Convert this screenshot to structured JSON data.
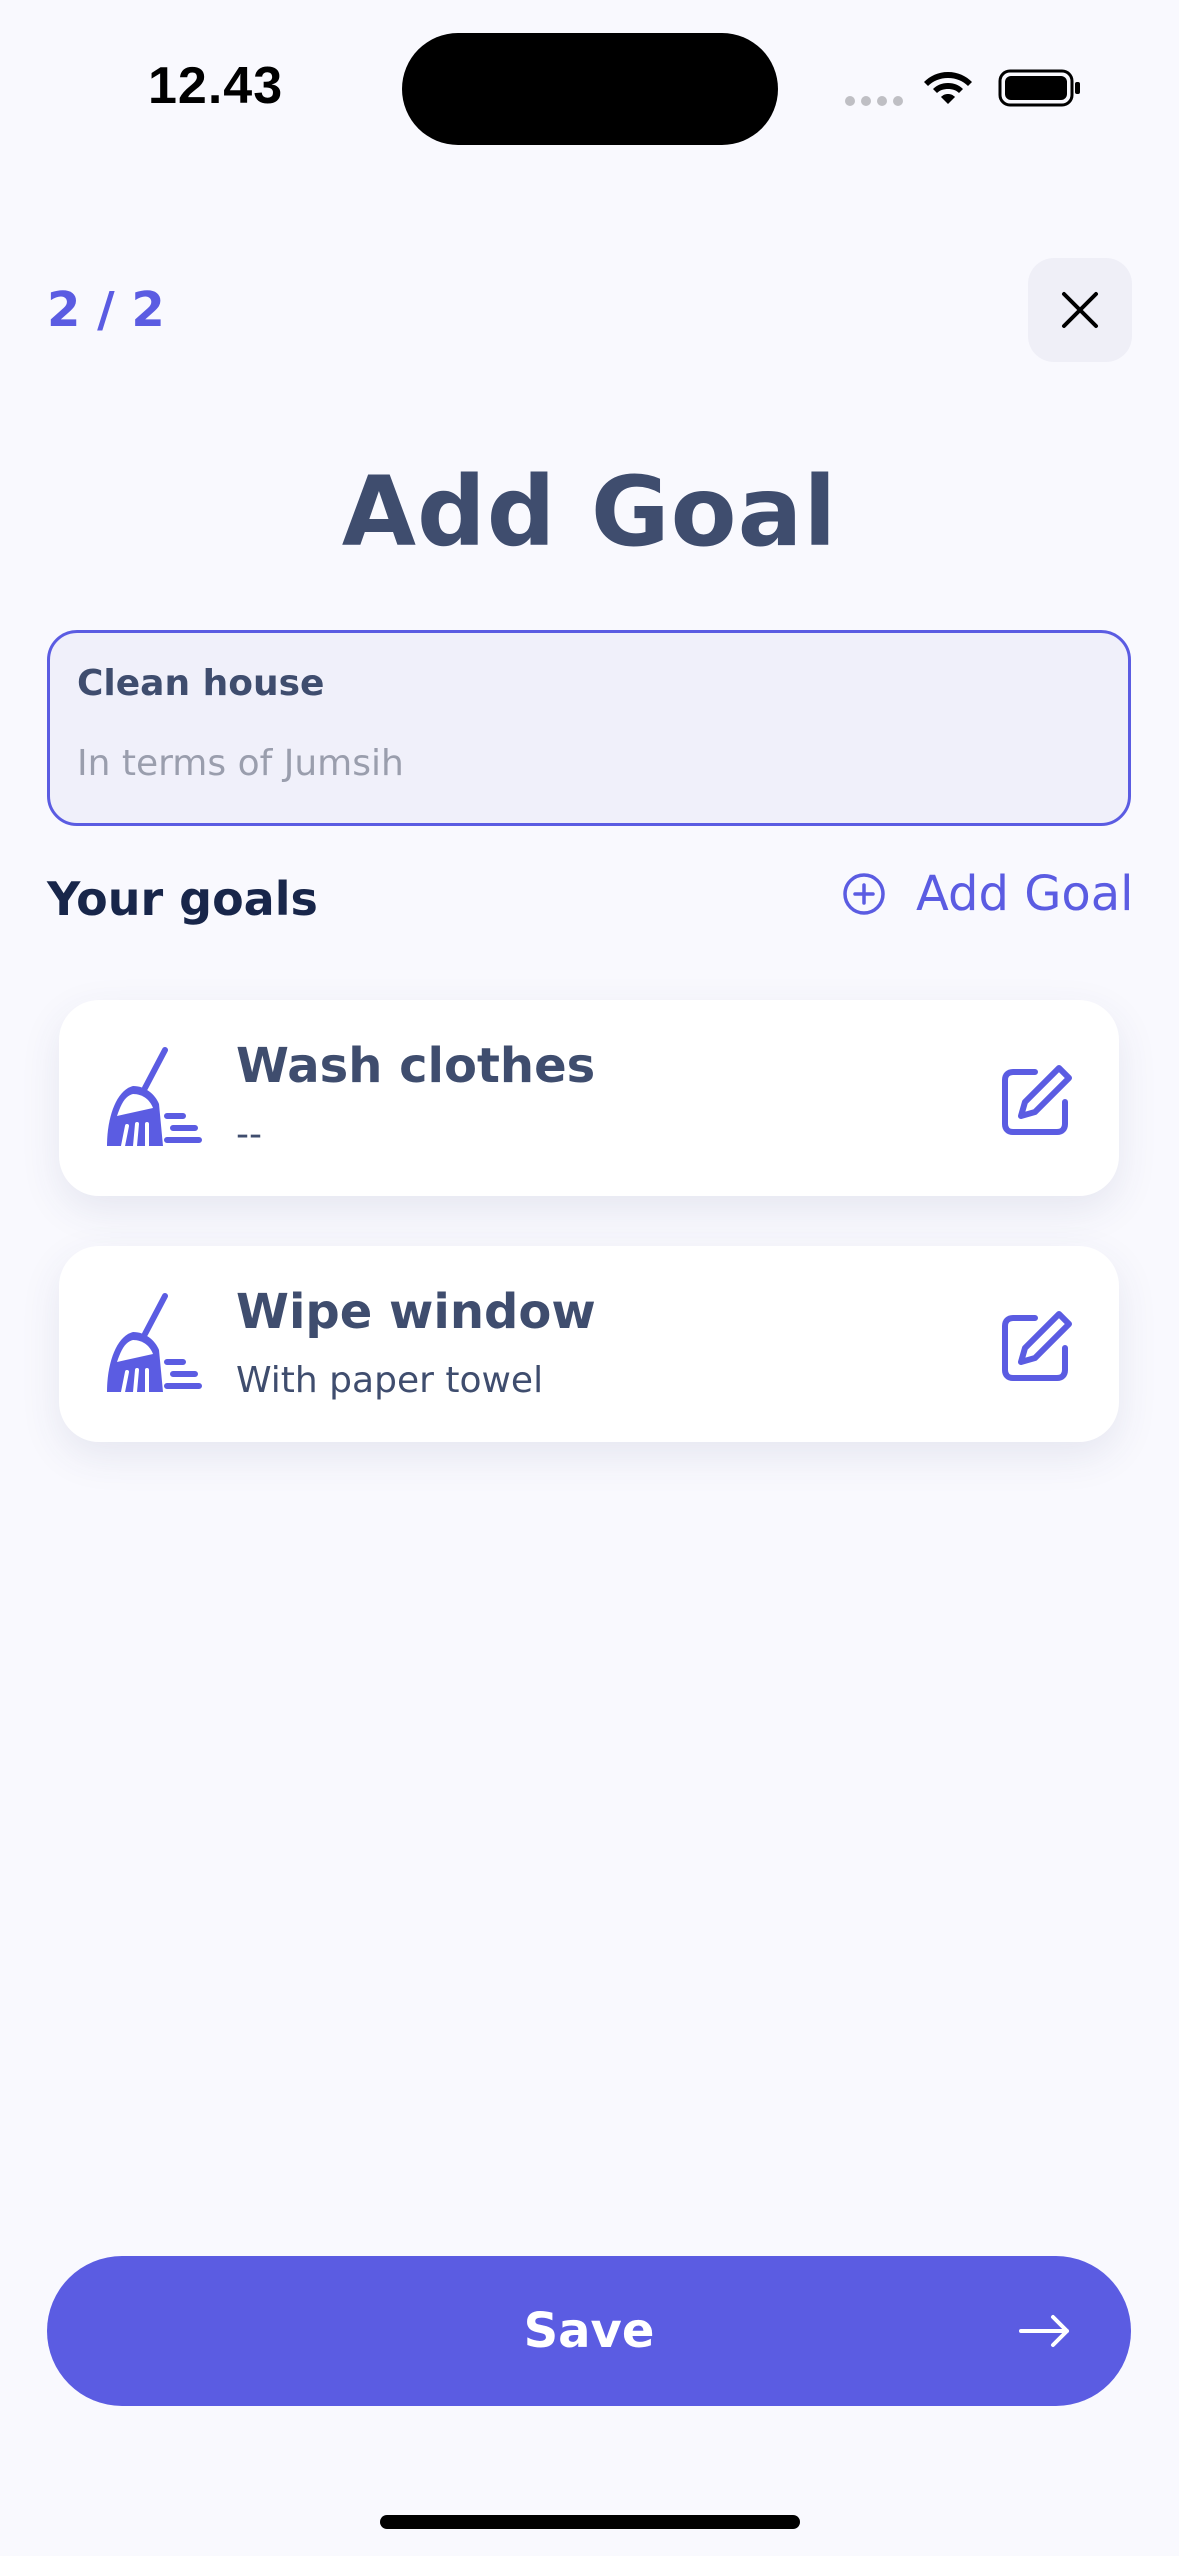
{
  "status_bar": {
    "time": "12.43"
  },
  "header": {
    "step": "2 / 2",
    "title": "Add Goal"
  },
  "goal_input": {
    "label": "Clean house",
    "value": "",
    "placeholder": "In terms of Jumsih"
  },
  "goals_section": {
    "title": "Your goals",
    "add_label": "Add Goal"
  },
  "goals": [
    {
      "title": "Wash clothes",
      "subtitle": "--",
      "icon": "broom-icon"
    },
    {
      "title": "Wipe window",
      "subtitle": "With paper towel",
      "icon": "broom-icon"
    }
  ],
  "footer": {
    "save_label": "Save"
  },
  "colors": {
    "accent": "#5B5CE2",
    "text": "#3F4D6E",
    "heading": "#18264A",
    "background": "#F9F9FE"
  }
}
